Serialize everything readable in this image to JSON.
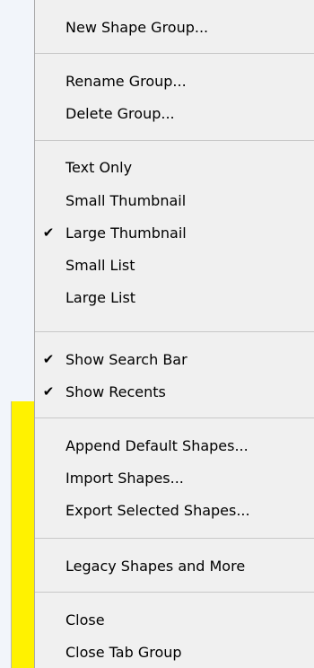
{
  "menu": {
    "items": [
      {
        "label": "New Shape Group...",
        "checked": false
      },
      {
        "label": "Rename Group...",
        "checked": false
      },
      {
        "label": "Delete Group...",
        "checked": false
      },
      {
        "label": "Text Only",
        "checked": false
      },
      {
        "label": "Small Thumbnail",
        "checked": false
      },
      {
        "label": "Large Thumbnail",
        "checked": true
      },
      {
        "label": "Small List",
        "checked": false
      },
      {
        "label": "Large List",
        "checked": false
      },
      {
        "label": "Show Search Bar",
        "checked": true
      },
      {
        "label": "Show Recents",
        "checked": true
      },
      {
        "label": "Append Default Shapes...",
        "checked": false
      },
      {
        "label": "Import Shapes...",
        "checked": false
      },
      {
        "label": "Export Selected Shapes...",
        "checked": false
      },
      {
        "label": "Legacy Shapes and More",
        "checked": false
      },
      {
        "label": "Close",
        "checked": false
      },
      {
        "label": "Close Tab Group",
        "checked": false
      }
    ],
    "check_glyph": "✔"
  },
  "colors": {
    "menu_background": "#f0f0f0",
    "separator": "#c8c8c8",
    "highlight_panel": "#fff200"
  }
}
